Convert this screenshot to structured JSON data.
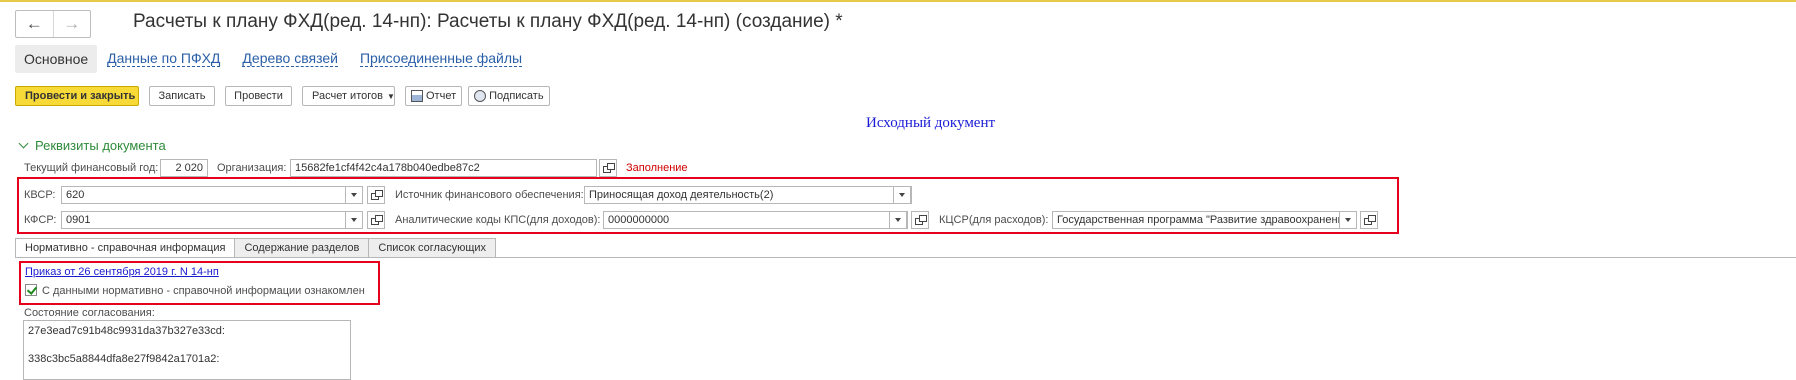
{
  "window": {
    "title": "Расчеты к плану ФХД(ред. 14-нп): Расчеты к плану ФХД(ред. 14-нп) (создание) *",
    "nav_back": "←",
    "nav_forward": "→"
  },
  "tabs": [
    {
      "label": "Основное"
    },
    {
      "label": "Данные по ПФХД"
    },
    {
      "label": "Дерево связей"
    },
    {
      "label": "Присоединенные файлы"
    }
  ],
  "toolbar": {
    "post_close": "Провести и закрыть",
    "save": "Записать",
    "post": "Провести",
    "calc_totals": "Расчет итогов",
    "report": "Отчет",
    "sign": "Подписать"
  },
  "source_document": "Исходный документ",
  "group": {
    "title": "Реквизиты документа"
  },
  "fields": {
    "fin_year_label": "Текущий финансовый год:",
    "fin_year_value": "2 020",
    "org_label": "Организация:",
    "org_value": "15682fe1cf4f42c4a178b040edbe87c2",
    "fill_label": "Заполнение",
    "kvsr_label": "КВСР:",
    "kvsr_value": "620",
    "source_label": "Источник финансового обеспечения:",
    "source_value": "Приносящая доход деятельность(2)",
    "kfsr_label": "КФСР:",
    "kfsr_value": "0901",
    "kps_label": "Аналитические коды КПС(для доходов):",
    "kps_value": "0000000000",
    "kcsr_label": "КЦСР(для расходов):",
    "kcsr_value": "Государственная программа \"Развитие здравоохранения\""
  },
  "subtabs": [
    {
      "label": "Нормативно - справочная информация"
    },
    {
      "label": "Содержание разделов"
    },
    {
      "label": "Список согласующих"
    }
  ],
  "normative": {
    "link": "Приказ от 26 сентября 2019 г. N 14-нп",
    "ack_label": "С данными нормативно - справочной информации ознакомлен",
    "ack_checked": true,
    "approval_label": "Состояние согласования:",
    "approval_lines": [
      "27e3ead7c91b48c9931da37b327e33cd:",
      "",
      "338c3bc5a8844dfa8e27f9842a1701a2:"
    ]
  },
  "colors": {
    "accent_yellow": "#f7d938",
    "link_blue": "#2a5fa8",
    "group_green": "#2e8b3a",
    "highlight_red": "#e5001c"
  }
}
